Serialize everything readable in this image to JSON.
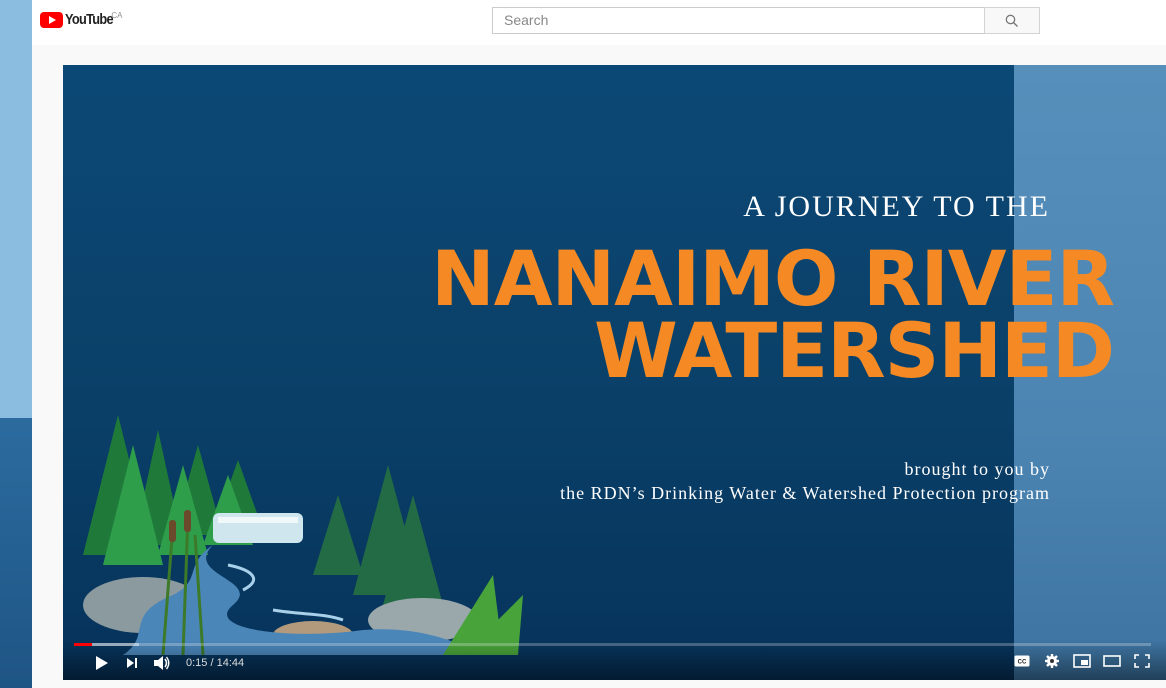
{
  "masthead": {
    "logo_text": "YouTube",
    "region": "CA",
    "search_placeholder": "Search"
  },
  "video": {
    "title_line1": "A JOURNEY TO THE",
    "title_line2": "NANAIMO RIVER",
    "title_line3": "WATERSHED",
    "subtitle_line1": "brought to you by",
    "subtitle_line2": "the RDN’s Drinking Water & Watershed Protection program",
    "accent_color": "#f58a24"
  },
  "player": {
    "current_time": "0:15",
    "separator": " / ",
    "duration": "14:44",
    "progress_fraction": 0.017,
    "buffered_fraction": 0.06,
    "icons": [
      "play-icon",
      "next-icon",
      "volume-icon",
      "captions-icon",
      "settings-icon",
      "miniplayer-icon",
      "theater-icon",
      "fullscreen-icon"
    ]
  }
}
